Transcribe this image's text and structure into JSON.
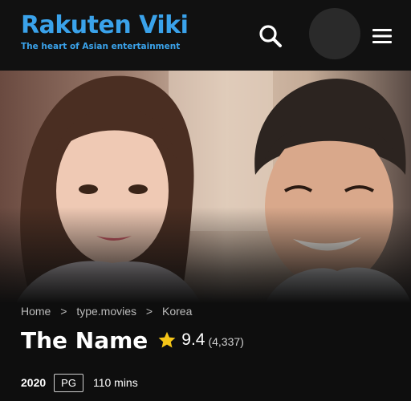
{
  "header": {
    "logo_text": "Rakuten Viki",
    "tagline": "The heart of Asian entertainment",
    "brand_color": "#3aa2ea",
    "search_icon": "search-icon",
    "avatar": "avatar",
    "menu_icon": "hamburger-menu-icon"
  },
  "breadcrumb": {
    "items": [
      "Home",
      "type.movies",
      "Korea"
    ],
    "separator": ">"
  },
  "title": {
    "name": "The Name",
    "rating_icon": "star-icon",
    "rating_color": "#f5c518",
    "rating": "9.4",
    "rating_count": "(4,337)"
  },
  "meta": {
    "year": "2020",
    "age_rating": "PG",
    "duration": "110 mins"
  }
}
